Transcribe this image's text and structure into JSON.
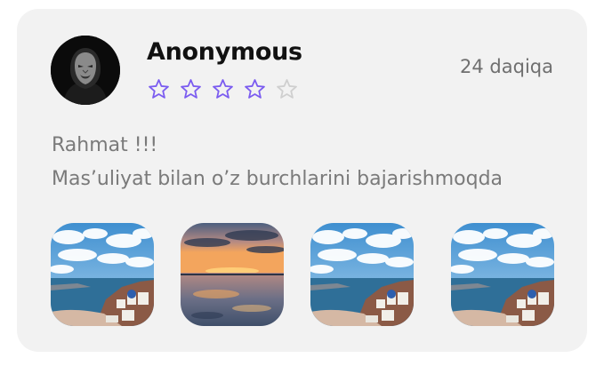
{
  "review": {
    "author_name": "Anonymous",
    "time_ago": "24 daqiqa",
    "rating": 4,
    "rating_max": 5,
    "lines": [
      "Rahmat !!!",
      "Mas’uliyat bilan o’z burchlarini bajarishmoqda"
    ]
  },
  "avatar": {
    "icon": "anonymous-mask-icon"
  },
  "photos": [
    {
      "kind": "santorini"
    },
    {
      "kind": "sunset-beach"
    },
    {
      "kind": "santorini"
    },
    {
      "kind": "santorini"
    }
  ],
  "colors": {
    "card_bg": "#f2f2f2",
    "star_filled": "#7b5cf0",
    "star_empty": "#cfcfcf",
    "text_primary": "#111111",
    "text_secondary": "#7a7a7a"
  }
}
